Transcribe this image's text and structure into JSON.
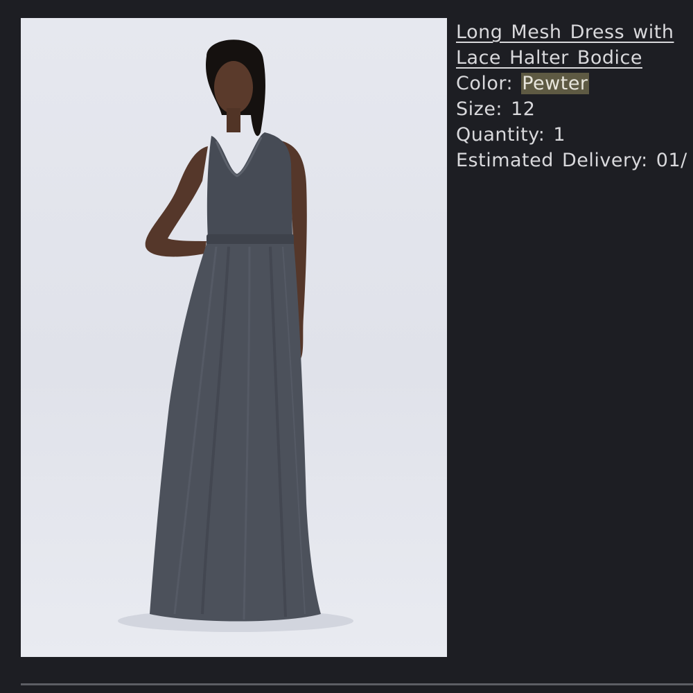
{
  "product": {
    "image_alt": "Model wearing long pewter mesh dress with lace halter bodice",
    "title_line1": "Long Mesh Dress with",
    "title_line2": "Lace Halter Bodice",
    "color_label": "Color:",
    "color_value": "Pewter",
    "size_label": "Size:",
    "size_value": "12",
    "quantity_label": "Quantity:",
    "quantity_value": "1",
    "delivery_label": "Estimated Delivery:",
    "delivery_value": "01/"
  },
  "colors": {
    "background": "#1d1e23",
    "text": "#d9d9dc",
    "highlight": "#5e5a43",
    "dress": "#4c515b"
  }
}
